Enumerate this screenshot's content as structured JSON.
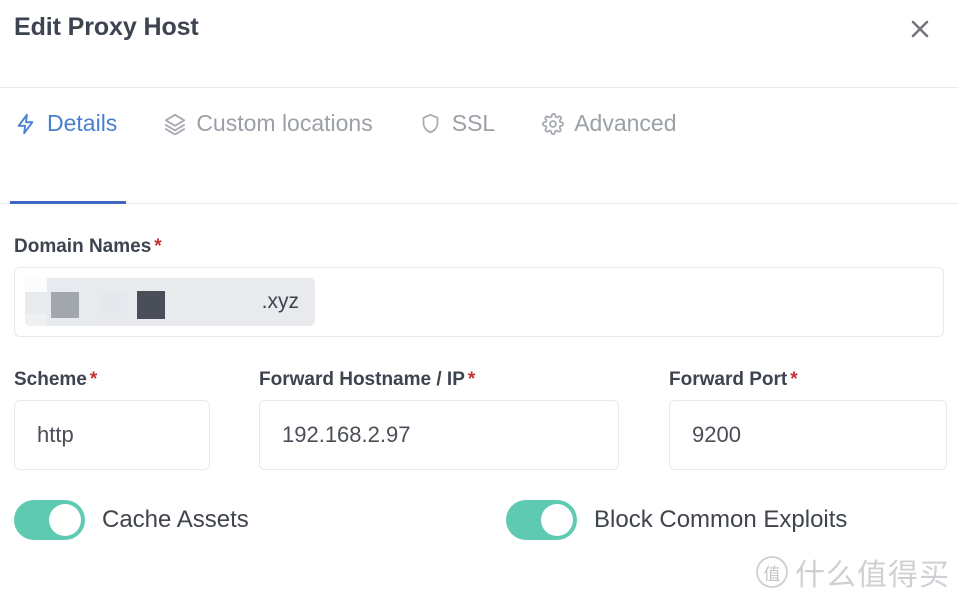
{
  "header": {
    "title": "Edit Proxy Host",
    "close_icon": "close-icon"
  },
  "tabs": [
    {
      "label": "Details",
      "icon": "zap-icon",
      "active": true
    },
    {
      "label": "Custom locations",
      "icon": "layers-icon",
      "active": false
    },
    {
      "label": "SSL",
      "icon": "shield-icon",
      "active": false
    },
    {
      "label": "Advanced",
      "icon": "gear-icon",
      "active": false
    }
  ],
  "fields": {
    "domain_names": {
      "label": "Domain Names",
      "required_marker": "*",
      "tag_text": ".xyz",
      "redacted": true
    },
    "scheme": {
      "label": "Scheme",
      "required_marker": "*",
      "value": "http"
    },
    "forward_hostname": {
      "label": "Forward Hostname / IP",
      "required_marker": "*",
      "value": "192.168.2.97"
    },
    "forward_port": {
      "label": "Forward Port",
      "required_marker": "*",
      "value": "9200"
    }
  },
  "toggles": [
    {
      "label": "Cache Assets",
      "on": true
    },
    {
      "label": "Block Common Exploits",
      "on": true
    }
  ],
  "watermark": {
    "logo_char": "值",
    "text": "什么值得买"
  },
  "colors": {
    "accent_blue": "#4a7fd0",
    "underline_blue": "#4067c0",
    "toggle_green": "#5ecab2",
    "required_red": "#c53030",
    "title_gray": "#3d4450",
    "muted_gray": "#9ba0a8",
    "border_gray": "#e6e9ef"
  }
}
